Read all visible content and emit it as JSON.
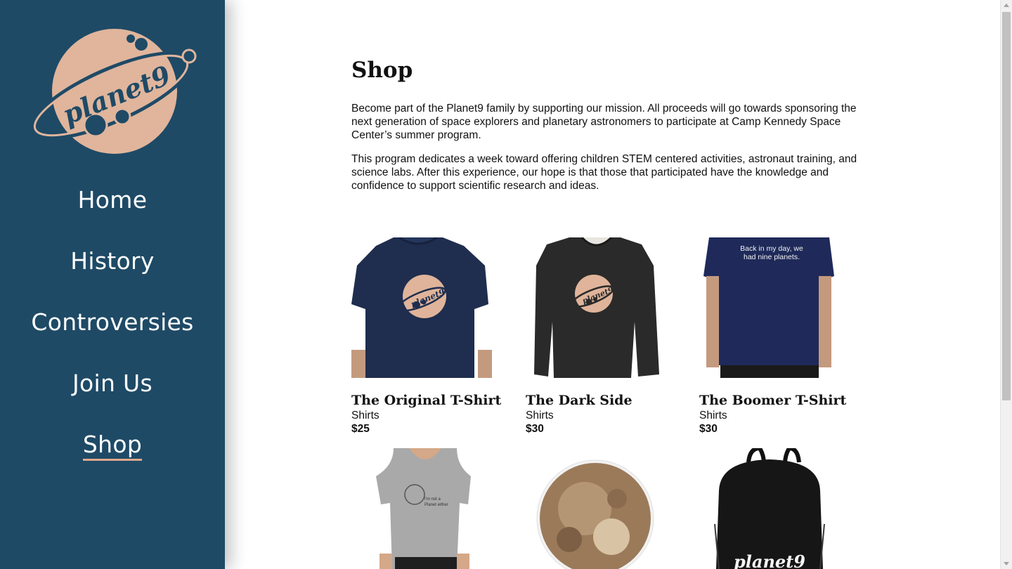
{
  "brand": {
    "logo_text": "planet9",
    "colors": {
      "sidebar": "#1e4a66",
      "accent": "#e0b59c"
    }
  },
  "nav": {
    "items": [
      {
        "label": "Home",
        "active": false
      },
      {
        "label": "History",
        "active": false
      },
      {
        "label": "Controversies",
        "active": false
      },
      {
        "label": "Join Us",
        "active": false
      },
      {
        "label": "Shop",
        "active": true
      }
    ]
  },
  "page": {
    "title": "Shop",
    "intro": [
      "Become part of the Planet9 family by supporting our mission. All proceeds will go towards sponsoring the next generation of space explorers and planetary astronomers to participate at Camp Kennedy Space Center’s summer program.",
      "This program dedicates a week toward offering children STEM centered activities, astronaut training, and science labs. After this experience, our hope is that those that participated have the knowledge and confidence to support scientific research and ideas."
    ]
  },
  "products": [
    {
      "name": "The Original T-Shirt",
      "category": "Shirts",
      "price": "$25",
      "image": "navy-tshirt-planet9-logo"
    },
    {
      "name": "The Dark Side",
      "category": "Shirts",
      "price": "$30",
      "image": "black-sweatshirt-planet9-logo"
    },
    {
      "name": "The Boomer T-Shirt",
      "category": "Shirts",
      "price": "$30",
      "image": "navy-tshirt-text",
      "image_text": "Back in my day, we had nine planets."
    },
    {
      "name": "",
      "category": "",
      "price": "",
      "image": "grey-womens-tshirt"
    },
    {
      "name": "",
      "category": "",
      "price": "",
      "image": "pluto-sticker"
    },
    {
      "name": "",
      "category": "",
      "price": "",
      "image": "black-backpack-planet9",
      "image_text": "planet9"
    }
  ]
}
